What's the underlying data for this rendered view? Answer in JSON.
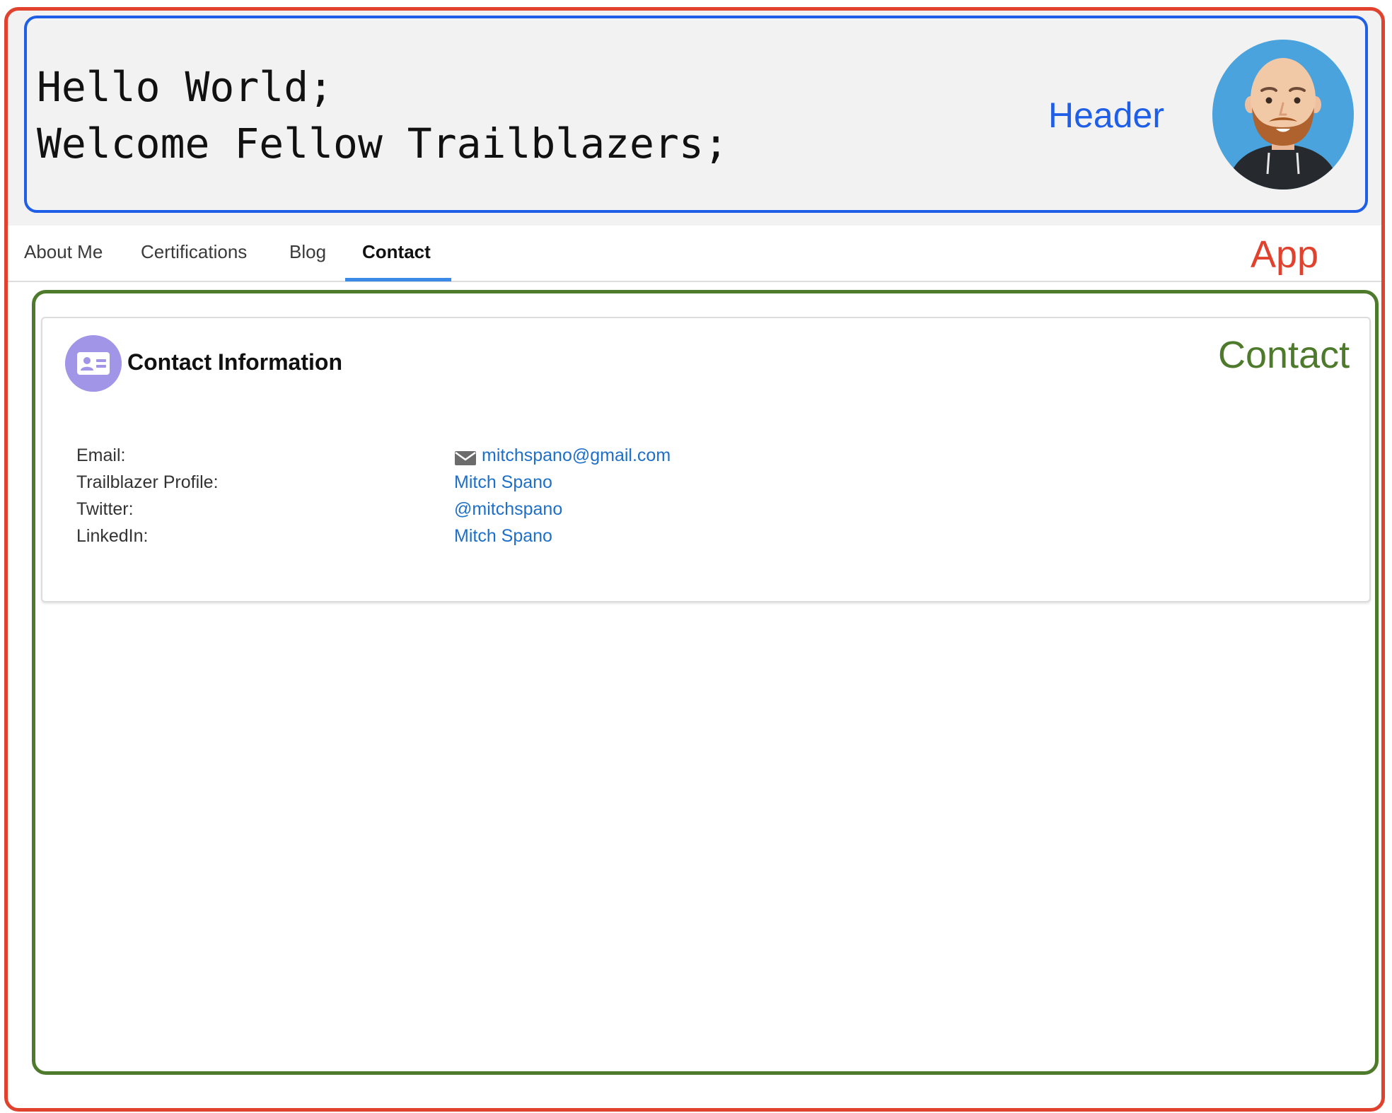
{
  "header": {
    "greeting_line_1": "Hello World;",
    "greeting_line_2": "Welcome Fellow Trailblazers;",
    "annotation_label": "Header",
    "avatar_icon": "avatar-illustration"
  },
  "app": {
    "annotation_label": "App"
  },
  "nav": {
    "tabs": [
      {
        "label": "About Me"
      },
      {
        "label": "Certifications"
      },
      {
        "label": "Blog"
      },
      {
        "label": "Contact"
      }
    ],
    "active_tab": "Contact"
  },
  "contact": {
    "annotation_label": "Contact",
    "card_title": "Contact Information",
    "card_icon": "contact-card-icon",
    "rows": [
      {
        "label": "Email:",
        "value": "mitchspano@gmail.com",
        "icon": "mail-icon"
      },
      {
        "label": "Trailblazer Profile:",
        "value": "Mitch Spano"
      },
      {
        "label": "Twitter:",
        "value": "@mitchspano"
      },
      {
        "label": "LinkedIn:",
        "value": "Mitch Spano"
      }
    ]
  },
  "colors": {
    "app_annotation": "#e0422e",
    "header_annotation": "#1f5ee6",
    "contact_annotation": "#4e7a2b",
    "link": "#1d6fc9",
    "active_tab_underline": "#3b8ae8",
    "card_icon_bg": "#a195e8",
    "avatar_bg": "#4aa3dc"
  }
}
